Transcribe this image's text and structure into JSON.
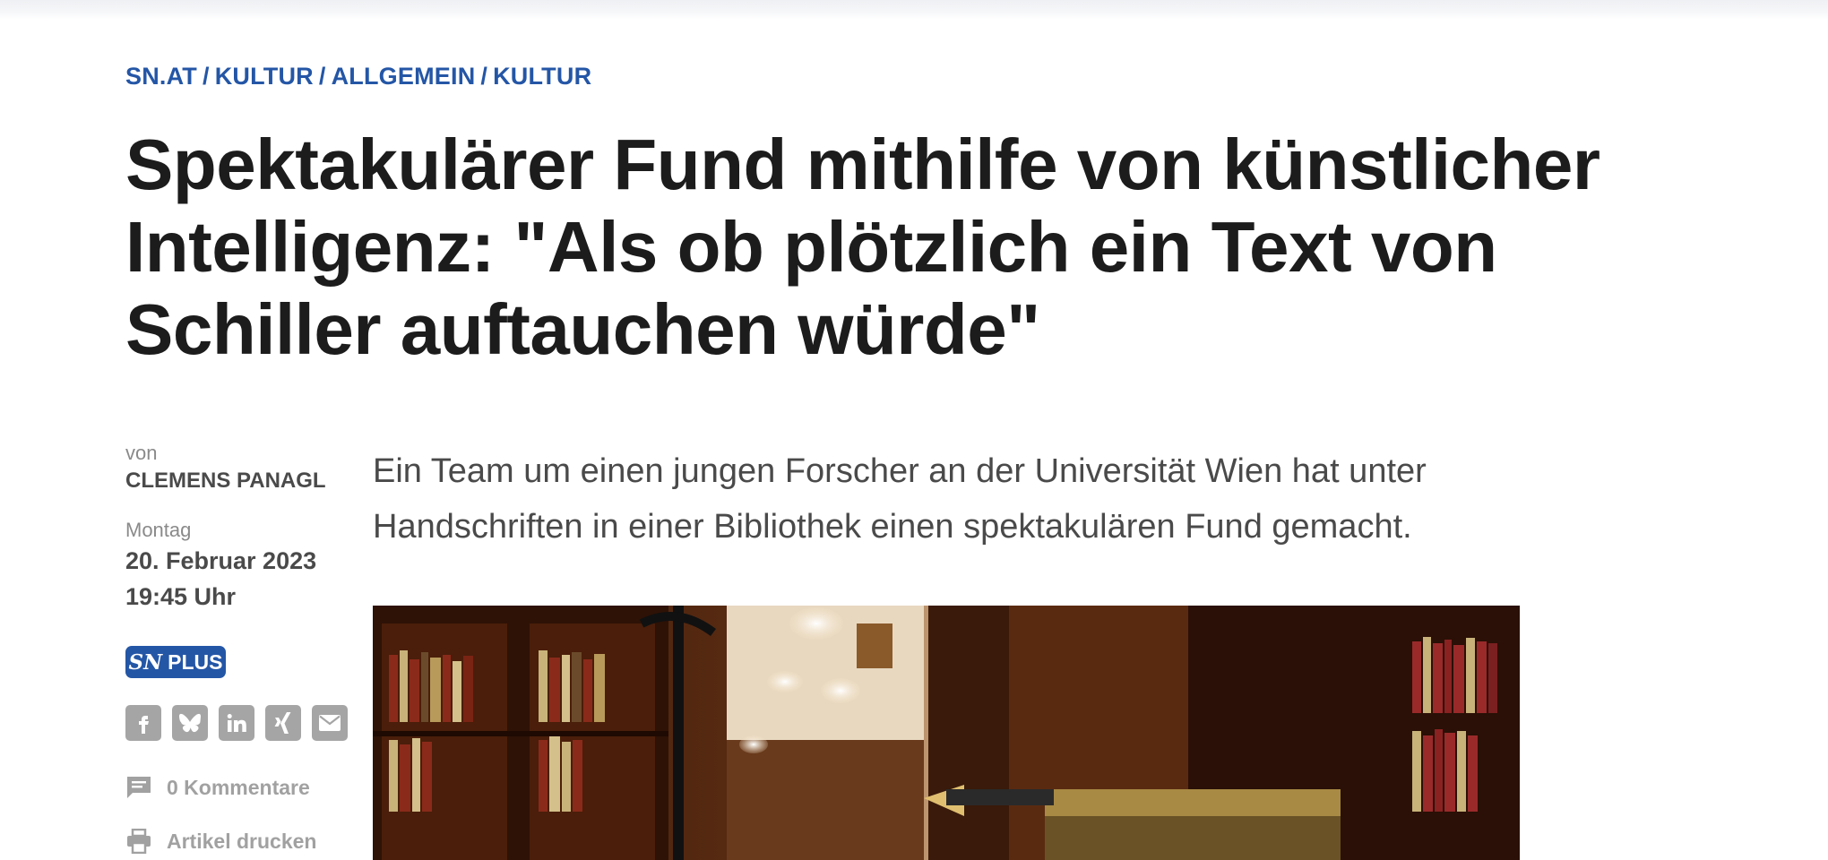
{
  "breadcrumb": {
    "items": [
      "SN.AT",
      "KULTUR",
      "ALLGEMEIN",
      "KULTUR"
    ],
    "separator": "/"
  },
  "article": {
    "headline": "Spektakulärer Fund mithilfe von künstlicher Intelligenz: \"Als ob plötzlich ein Text von Schiller auftauchen würde\"",
    "lead": "Ein Team um einen jungen Forscher an der Universität Wien hat unter Handschriften in einer Bibliothek einen spektakulären Fund gemacht."
  },
  "meta": {
    "author_label": "von",
    "author": "CLEMENS PANAGL",
    "weekday": "Montag",
    "date": "20. Februar 2023",
    "time": "19:45 Uhr"
  },
  "plus_badge": {
    "logo": "SN",
    "label": "PLUS",
    "color": "#2456a6"
  },
  "share": {
    "icons": [
      "facebook-icon",
      "bluesky-icon",
      "linkedin-icon",
      "xing-icon",
      "email-icon"
    ],
    "color": "#a5a5a5"
  },
  "tools": {
    "comments_label": "0 Kommentare",
    "print_label": "Artikel drucken"
  },
  "colors": {
    "accent": "#2456a6",
    "headline": "#1c1c1c",
    "body": "#4a4a4a",
    "muted": "#8a8a8a"
  }
}
